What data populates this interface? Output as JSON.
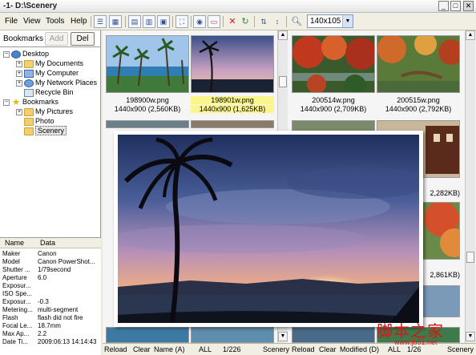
{
  "window": {
    "title": "-1- D:\\Scenery",
    "minimize_glyph": "_",
    "maximize_glyph": "□",
    "close_glyph": "✕"
  },
  "menu": [
    "File",
    "View",
    "Tools",
    "Help"
  ],
  "toolbar": {
    "icons": [
      "list-view-icon",
      "thumbnail-view-icon",
      "small-thumb-icon",
      "medium-thumb-icon",
      "large-thumb-icon",
      "fullscreen-icon",
      "slideshow-icon",
      "screen-icon",
      "delete-icon",
      "refresh-icon",
      "sort-icon",
      "sort-order-icon",
      "zoom-icon"
    ],
    "size_value": "140x105"
  },
  "bookmarks": {
    "label": "Bookmarks",
    "add_label": "Add",
    "del_label": "Del"
  },
  "tree": {
    "desktop": "Desktop",
    "my_documents": "My Documents",
    "my_computer": "My Computer",
    "my_network": "My Network Places",
    "recycle_bin": "Recycle Bin",
    "bookmarks": "Bookmarks",
    "my_pictures": "My Pictures",
    "photo": "Photo",
    "scenery": "Scenery"
  },
  "exif": {
    "col_name": "Name",
    "col_data": "Data",
    "rows": [
      {
        "k": "Maker",
        "v": "Canon"
      },
      {
        "k": "Model",
        "v": "Canon PowerShot..."
      },
      {
        "k": "Shutter ...",
        "v": "1/79second"
      },
      {
        "k": "Aperture",
        "v": "6.0"
      },
      {
        "k": "Exposur...",
        "v": ""
      },
      {
        "k": "ISO Spe...",
        "v": ""
      },
      {
        "k": "Exposur...",
        "v": "-0.3"
      },
      {
        "k": "Metering...",
        "v": "multi-segment"
      },
      {
        "k": "Flash",
        "v": "flash did not fire"
      },
      {
        "k": "Focal Le...",
        "v": "18.7mm"
      },
      {
        "k": "Max Ap...",
        "v": "2.2"
      },
      {
        "k": "Date Ti...",
        "v": "2009:06:13 14:14:43"
      }
    ]
  },
  "thumbs": [
    {
      "name": "198900w.png",
      "info": "1440x900 (2,560KB)"
    },
    {
      "name": "198901w.png",
      "info": "1440x900 (1,625KB)"
    },
    {
      "name": "200514w.png",
      "info": "1440x900 (2,709KB)"
    },
    {
      "name": "200515w.png",
      "info": "1440x900 (2,792KB)"
    },
    {
      "name": "",
      "info": "2,282KB)"
    },
    {
      "name": "",
      "info": "2,861KB)"
    }
  ],
  "status": {
    "reload": "Reload",
    "clear": "Clear",
    "sort": "Name (A)",
    "all": "ALL",
    "count": "1/226",
    "folder": "Scenery",
    "reload2": "Reload",
    "clear2": "Clear",
    "modified": "Modified (D)",
    "all2": "ALL",
    "count2": "1/26",
    "folder2": "Scenery"
  },
  "watermark": {
    "text": "脚本之家",
    "url": "www.jb51.net"
  }
}
